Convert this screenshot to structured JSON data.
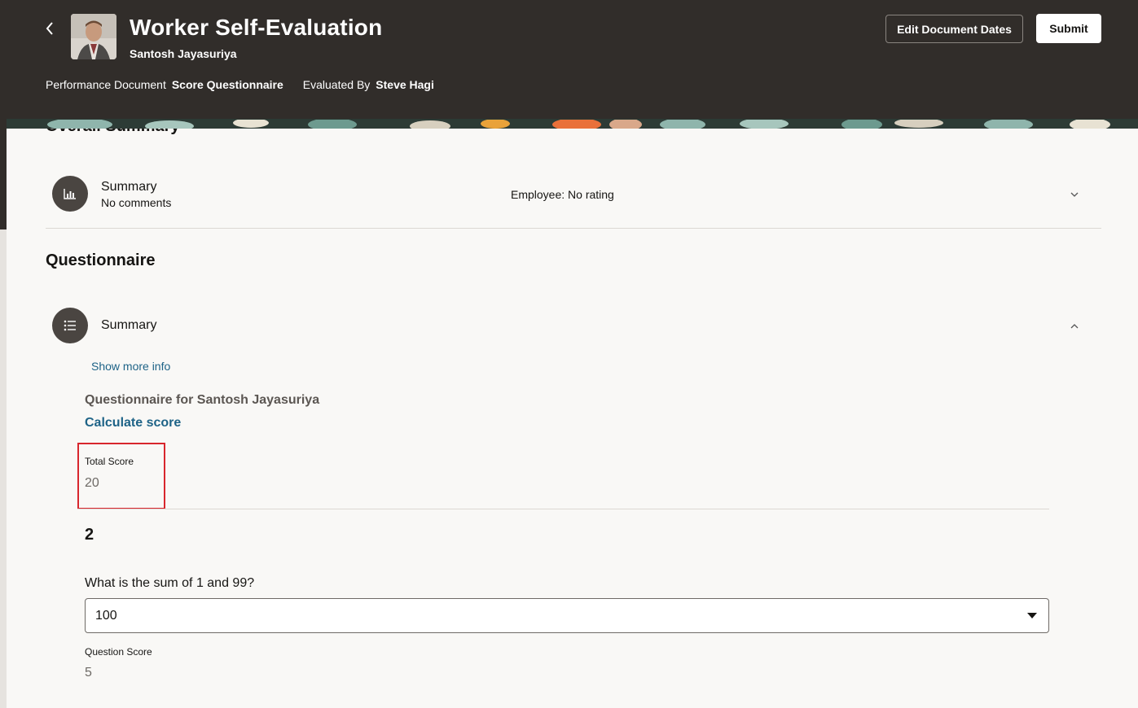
{
  "header": {
    "title": "Worker Self-Evaluation",
    "subtitle": "Santosh Jayasuriya",
    "meta": [
      {
        "label": "Performance Document",
        "value": "Score Questionnaire"
      },
      {
        "label": "Evaluated By",
        "value": "Steve Hagi"
      }
    ],
    "edit_dates_label": "Edit Document Dates",
    "submit_label": "Submit",
    "back_icon": "chevron-left-icon"
  },
  "overall": {
    "heading": "Overall Summary",
    "summary_title": "Summary",
    "summary_comments": "No comments",
    "rating": "Employee: No rating",
    "icon": "bar-chart-icon",
    "chevron": "chevron-down-icon"
  },
  "questionnaire": {
    "heading": "Questionnaire",
    "section_title": "Summary",
    "icon": "list-icon",
    "chevron": "chevron-up-icon",
    "show_more": "Show more info",
    "for_title": "Questionnaire for Santosh Jayasuriya",
    "calculate": "Calculate score",
    "total_score_label": "Total Score",
    "total_score_value": "20",
    "question_number": "2",
    "question_text": "What is the sum of 1 and 99?",
    "selected_answer": "100",
    "question_score_label": "Question Score",
    "question_score_value": "5"
  },
  "colors": {
    "header_bg": "#312d2a",
    "link": "#1e6387",
    "highlight": "#d8262d"
  }
}
